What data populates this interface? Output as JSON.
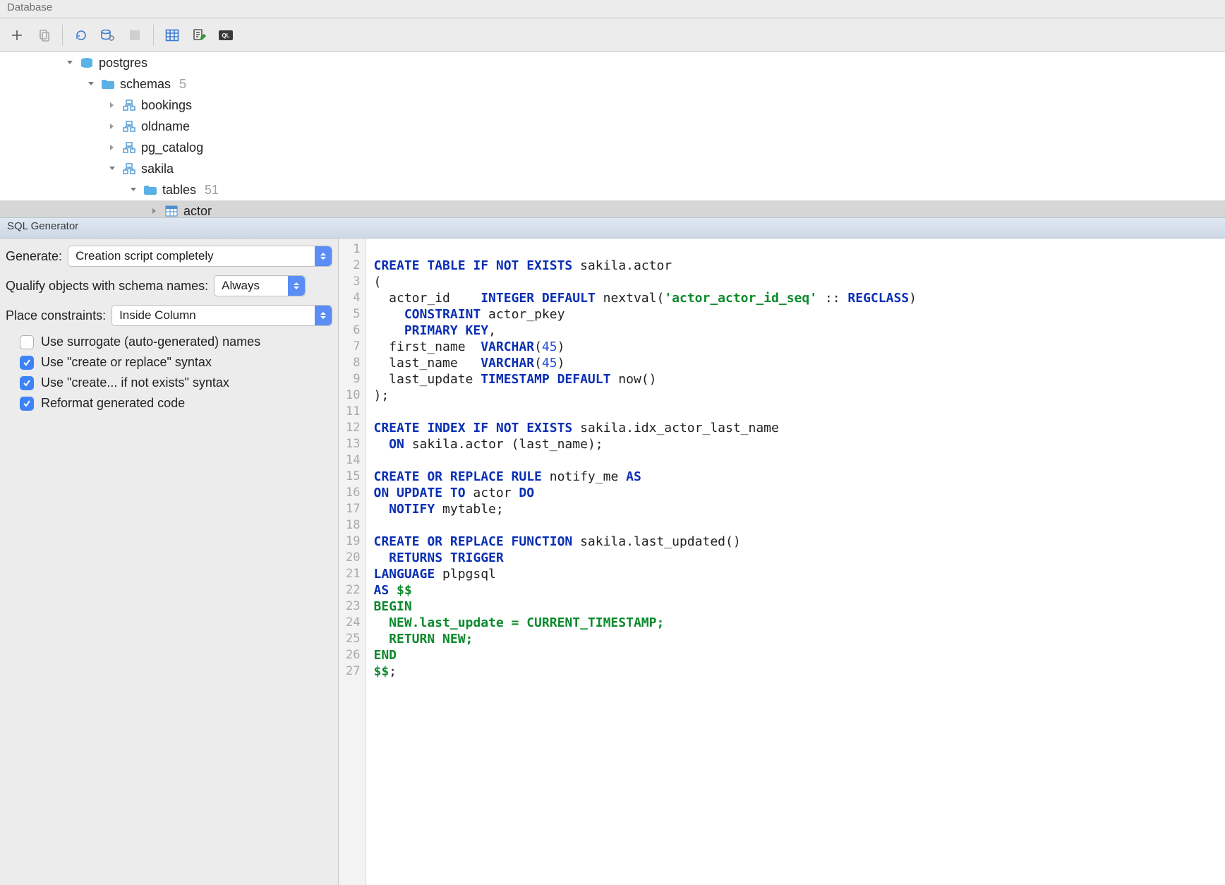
{
  "window": {
    "title": "Database"
  },
  "tree": {
    "root": {
      "label": "postgres"
    },
    "schemas": {
      "label": "schemas",
      "count": "5"
    },
    "schema_items": [
      {
        "label": "bookings"
      },
      {
        "label": "oldname"
      },
      {
        "label": "pg_catalog"
      },
      {
        "label": "sakila"
      }
    ],
    "tables": {
      "label": "tables",
      "count": "51"
    },
    "actor": {
      "label": "actor"
    }
  },
  "sqlgen": {
    "title": "SQL Generator",
    "generate_label": "Generate:",
    "generate_value": "Creation script completely",
    "qualify_label": "Qualify objects with schema names:",
    "qualify_value": "Always",
    "constraints_label": "Place constraints:",
    "constraints_value": "Inside Column",
    "opts": {
      "surrogate": "Use surrogate (auto-generated) names",
      "create_replace": "Use \"create or replace\" syntax",
      "if_not_exists": "Use \"create... if not exists\" syntax",
      "reformat": "Reformat generated code"
    }
  },
  "code": {
    "line_count": 27,
    "l1": {
      "a": "CREATE TABLE IF NOT EXISTS",
      "b": " sakila.actor"
    },
    "l2": "(",
    "l3": {
      "a": "  actor_id    ",
      "b": "INTEGER DEFAULT",
      "c": " nextval(",
      "d": "'actor_actor_id_seq'",
      "e": " :: ",
      "f": "REGCLASS",
      "g": ")"
    },
    "l4": {
      "a": "    ",
      "b": "CONSTRAINT",
      "c": " actor_pkey"
    },
    "l5": {
      "a": "    ",
      "b": "PRIMARY KEY",
      "c": ","
    },
    "l6": {
      "a": "  first_name  ",
      "b": "VARCHAR",
      "c": "(",
      "d": "45",
      "e": ")"
    },
    "l7": {
      "a": "  last_name   ",
      "b": "VARCHAR",
      "c": "(",
      "d": "45",
      "e": ")"
    },
    "l8": {
      "a": "  last_update ",
      "b": "TIMESTAMP DEFAULT",
      "c": " now()"
    },
    "l9": ");",
    "l11": {
      "a": "CREATE INDEX IF NOT EXISTS",
      "b": " sakila.idx_actor_last_name"
    },
    "l12": {
      "a": "  ",
      "b": "ON",
      "c": " sakila.actor (last_name);"
    },
    "l14": {
      "a": "CREATE OR REPLACE RULE",
      "b": " notify_me ",
      "c": "AS"
    },
    "l15": {
      "a": "ON UPDATE TO",
      "b": " actor ",
      "c": "DO"
    },
    "l16": {
      "a": "  ",
      "b": "NOTIFY",
      "c": " mytable;"
    },
    "l18": {
      "a": "CREATE OR REPLACE FUNCTION",
      "b": " sakila.last_updated()"
    },
    "l19": {
      "a": "  ",
      "b": "RETURNS TRIGGER"
    },
    "l20": {
      "a": "LANGUAGE",
      "b": " plpgsql"
    },
    "l21": {
      "a": "AS ",
      "b": "$$"
    },
    "l22": "BEGIN",
    "l23": "  NEW.last_update = CURRENT_TIMESTAMP;",
    "l24": "  RETURN NEW;",
    "l25": "END",
    "l26": {
      "a": "$$",
      "b": ";"
    }
  }
}
